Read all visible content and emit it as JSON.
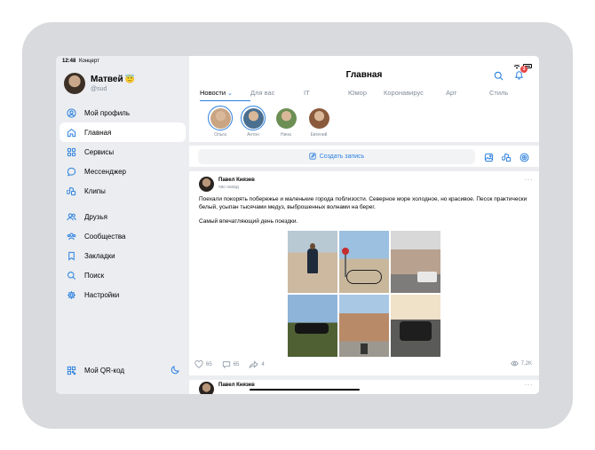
{
  "status_bar": {
    "time": "12:48",
    "carrier": "Концерт"
  },
  "profile": {
    "name": "Матвей",
    "emoji": "😇",
    "handle": "@sud"
  },
  "nav": {
    "items": [
      {
        "label": "Мой профиль",
        "icon": "user-circle-icon"
      },
      {
        "label": "Главная",
        "icon": "home-icon",
        "active": true
      },
      {
        "label": "Сервисы",
        "icon": "grid-icon"
      },
      {
        "label": "Мессенджер",
        "icon": "message-icon"
      },
      {
        "label": "Клипы",
        "icon": "clips-icon"
      },
      {
        "label": "Друзья",
        "icon": "users-icon"
      },
      {
        "label": "Сообщества",
        "icon": "community-icon"
      },
      {
        "label": "Закладки",
        "icon": "bookmark-icon"
      },
      {
        "label": "Поиск",
        "icon": "search-icon"
      },
      {
        "label": "Настройки",
        "icon": "gear-icon"
      }
    ],
    "qr_label": "Мой QR-код"
  },
  "header": {
    "title": "Главная",
    "notification_count": "3",
    "tabs": [
      {
        "label": "Новости",
        "active": true
      },
      {
        "label": "Для вас"
      },
      {
        "label": "IT"
      },
      {
        "label": "Юмор"
      },
      {
        "label": "Коронавирус"
      },
      {
        "label": "Арт"
      },
      {
        "label": "Стиль"
      }
    ]
  },
  "stories": [
    {
      "name": "Ольга",
      "color": "#c9a584",
      "seen": false
    },
    {
      "name": "Антон",
      "color": "#4b6f8f",
      "seen": false
    },
    {
      "name": "Нина",
      "color": "#6c8f54",
      "seen": true
    },
    {
      "name": "Евгений",
      "color": "#8a5a3c",
      "seen": true
    }
  ],
  "create": {
    "label": "Создать запись"
  },
  "post": {
    "author": "Павел Князев",
    "time": "час назад",
    "text": "Поехали покорять побережье и маленькие города поблизости. Северное море холодное, но красивое. Песок практически белый, усыпан тысячами медуз, выброшенных волнами на берег.",
    "text2": "Самый впечатляющий день поездки.",
    "likes": "65",
    "comments": "65",
    "shares": "4",
    "views": "7,2K"
  },
  "post2": {
    "author": "Павел Князев"
  },
  "colors": {
    "accent": "#2d81e0",
    "badge": "#e64646",
    "muted": "#818c99"
  }
}
